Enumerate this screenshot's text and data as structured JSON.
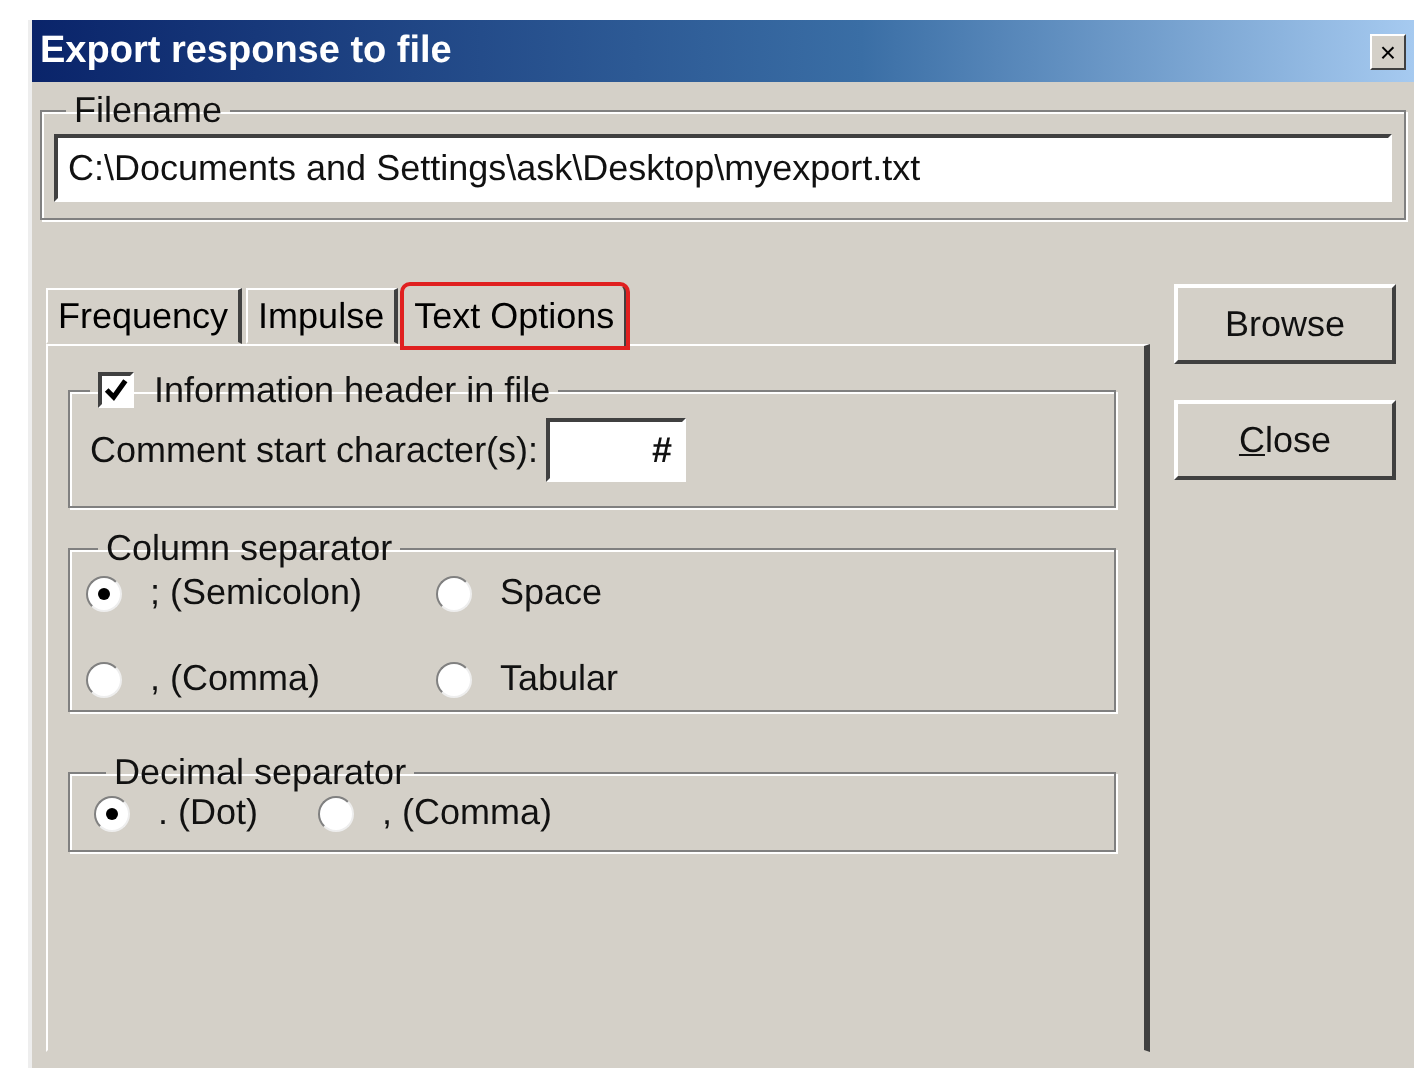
{
  "window": {
    "title": "Export response to file",
    "close": "×"
  },
  "filename": {
    "label": "Filename",
    "value": "C:\\Documents and Settings\\ask\\Desktop\\myexport.txt"
  },
  "tabs": [
    {
      "label": "Frequency",
      "selected": false
    },
    {
      "label": "Impulse",
      "selected": false
    },
    {
      "label": "Text Options",
      "selected": true
    }
  ],
  "header_group": {
    "label": "Information header in file",
    "checked": true,
    "comment_label": "Comment start character(s):",
    "comment_value": "#"
  },
  "column_separator": {
    "title": "Column separator",
    "options": [
      {
        "label": "; (Semicolon)",
        "selected": true
      },
      {
        "label": "Space",
        "selected": false
      },
      {
        "label": ", (Comma)",
        "selected": false
      },
      {
        "label": "Tabular",
        "selected": false
      }
    ]
  },
  "decimal_separator": {
    "title": "Decimal separator",
    "options": [
      {
        "label": ". (Dot)",
        "selected": true
      },
      {
        "label": ", (Comma)",
        "selected": false
      }
    ]
  },
  "buttons": [
    {
      "label": "Browse",
      "accelerator": false
    },
    {
      "label": "Close",
      "accelerator": true
    }
  ]
}
